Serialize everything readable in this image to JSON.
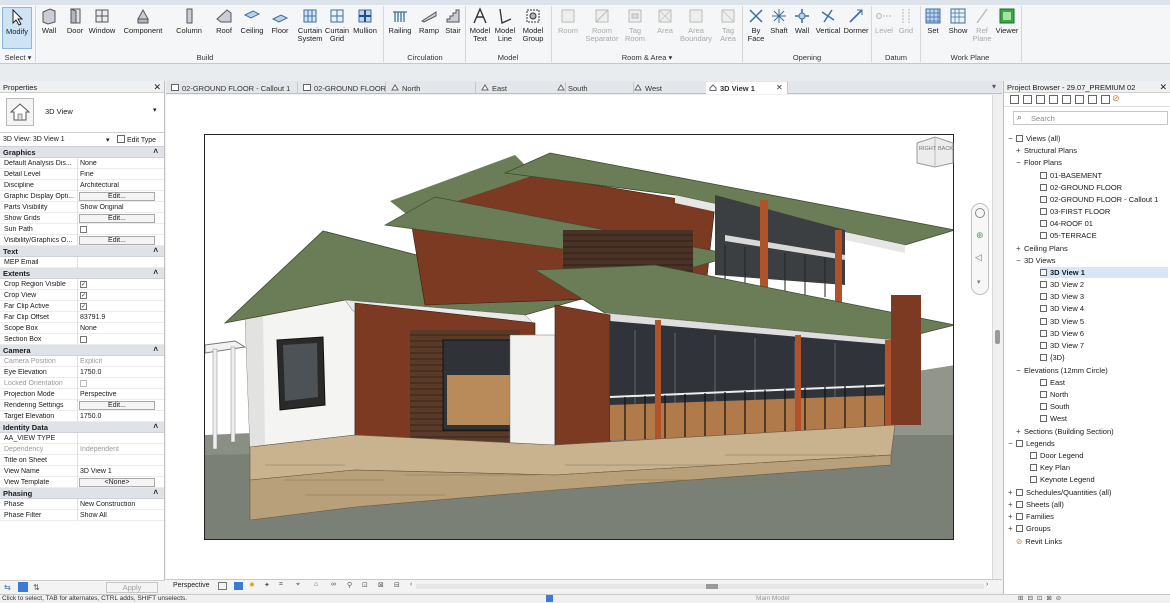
{
  "ribbon": {
    "buttons": {
      "modify": "Modify",
      "wall": "Wall",
      "door": "Door",
      "window": "Window",
      "component": "Component",
      "column": "Column",
      "roof": "Roof",
      "ceiling": "Ceiling",
      "floor": "Floor",
      "curtain_system": "Curtain System",
      "curtain_grid": "Curtain Grid",
      "mullion": "Mullion",
      "railing": "Railing",
      "ramp": "Ramp",
      "stair": "Stair",
      "model_text": "Model Text",
      "model_line": "Model Line",
      "model_group": "Model Group",
      "room": "Room",
      "room_separator": "Room Separator",
      "tag_room": "Tag Room",
      "area": "Area",
      "area_boundary": "Area Boundary",
      "tag_area": "Tag Area",
      "by_face": "By Face",
      "shaft": "Shaft",
      "wall_opening": "Wall",
      "vertical": "Vertical",
      "dormer": "Dormer",
      "level": "Level",
      "grid": "Grid",
      "set": "Set",
      "show": "Show",
      "ref_plane": "Ref Plane",
      "viewer": "Viewer"
    },
    "groups": {
      "select": "Select ▾",
      "build": "Build",
      "circulation": "Circulation",
      "model": "Model",
      "room_area": "Room & Area ▾",
      "opening": "Opening",
      "datum": "Datum",
      "work_plane": "Work Plane"
    }
  },
  "properties": {
    "title": "Properties",
    "type_name": "3D View",
    "instance_label": "3D View: 3D View 1",
    "edit_type": "Edit Type",
    "apply": "Apply",
    "categories": {
      "graphics": "Graphics",
      "text": "Text",
      "extents": "Extents",
      "camera": "Camera",
      "identity": "Identity Data",
      "phasing": "Phasing"
    },
    "rows": {
      "default_analysis": {
        "k": "Default Analysis Dis...",
        "v": "None"
      },
      "detail_level": {
        "k": "Detail Level",
        "v": "Fine"
      },
      "discipline": {
        "k": "Discipline",
        "v": "Architectural"
      },
      "graphic_display": {
        "k": "Graphic Display Opti...",
        "v": "Edit..."
      },
      "parts_visibility": {
        "k": "Parts Visibility",
        "v": "Show Original"
      },
      "show_grids": {
        "k": "Show Grids",
        "v": "Edit..."
      },
      "sun_path": {
        "k": "Sun Path",
        "v": ""
      },
      "visibility_graphics": {
        "k": "Visibility/Graphics O...",
        "v": "Edit..."
      },
      "mep_email": {
        "k": "MEP Email",
        "v": ""
      },
      "crop_region_visible": {
        "k": "Crop Region Visible",
        "v": "✓"
      },
      "crop_view": {
        "k": "Crop View",
        "v": "✓"
      },
      "far_clip_active": {
        "k": "Far Clip Active",
        "v": "✓"
      },
      "far_clip_offset": {
        "k": "Far Clip Offset",
        "v": "83791.9"
      },
      "scope_box": {
        "k": "Scope Box",
        "v": "None"
      },
      "section_box": {
        "k": "Section Box",
        "v": ""
      },
      "camera_position": {
        "k": "Camera Position",
        "v": "Explicit"
      },
      "eye_elevation": {
        "k": "Eye Elevation",
        "v": "1750.0"
      },
      "locked_orientation": {
        "k": "Locked Orientation",
        "v": ""
      },
      "projection_mode": {
        "k": "Projection Mode",
        "v": "Perspective"
      },
      "rendering_settings": {
        "k": "Rendering Settings",
        "v": "Edit..."
      },
      "target_elevation": {
        "k": "Target Elevation",
        "v": "1750.0"
      },
      "aa_view_type": {
        "k": "AA_VIEW TYPE",
        "v": ""
      },
      "dependency": {
        "k": "Dependency",
        "v": "Independent"
      },
      "title_on_sheet": {
        "k": "Title on Sheet",
        "v": ""
      },
      "view_name": {
        "k": "View Name",
        "v": "3D View 1"
      },
      "view_template": {
        "k": "View Template",
        "v": "<None>"
      },
      "phase": {
        "k": "Phase",
        "v": "New Construction"
      },
      "phase_filter": {
        "k": "Phase Filter",
        "v": "Show All"
      }
    }
  },
  "tabs": [
    "02-GROUND FLOOR - Callout 1",
    "02-GROUND FLOOR",
    "North",
    "East",
    "South",
    "West",
    "3D View 1"
  ],
  "viewcube": {
    "left": "RIGHT",
    "right": "BACK"
  },
  "view_control": {
    "mode": "Perspective"
  },
  "browser": {
    "title": "Project Browser - 29.07_PREMIUM 02",
    "search_placeholder": "Search",
    "views_all": "Views (all)",
    "structural_plans": "Structural Plans",
    "floor_plans": "Floor Plans",
    "fp_items": [
      "01-BASEMENT",
      "02-GROUND FLOOR",
      "02-GROUND FLOOR - Callout 1",
      "03-FIRST FLOOR",
      "04-ROOF 01",
      "05-TERRACE"
    ],
    "ceiling_plans": "Ceiling Plans",
    "views_3d": "3D Views",
    "v3d_items": [
      "3D View 1",
      "3D View 2",
      "3D View 3",
      "3D View 4",
      "3D View 5",
      "3D View 6",
      "3D View 7",
      "{3D}"
    ],
    "elevations": "Elevations (12mm Circle)",
    "elev_items": [
      "East",
      "North",
      "South",
      "West"
    ],
    "sections": "Sections (Building Section)",
    "legends": "Legends",
    "legend_items": [
      "Door Legend",
      "Key Plan",
      "Keynote Legend"
    ],
    "schedules": "Schedules/Quantities (all)",
    "sheets": "Sheets (all)",
    "families": "Families",
    "groups": "Groups",
    "revit_links": "Revit Links"
  },
  "status": {
    "hint": "Click to select, TAB for alternates, CTRL adds, SHIFT unselects.",
    "model": "Main Model"
  },
  "colors": {
    "accent": "#2a6fc9",
    "roof": "#6b7d56",
    "wall": "#7d3a22"
  }
}
